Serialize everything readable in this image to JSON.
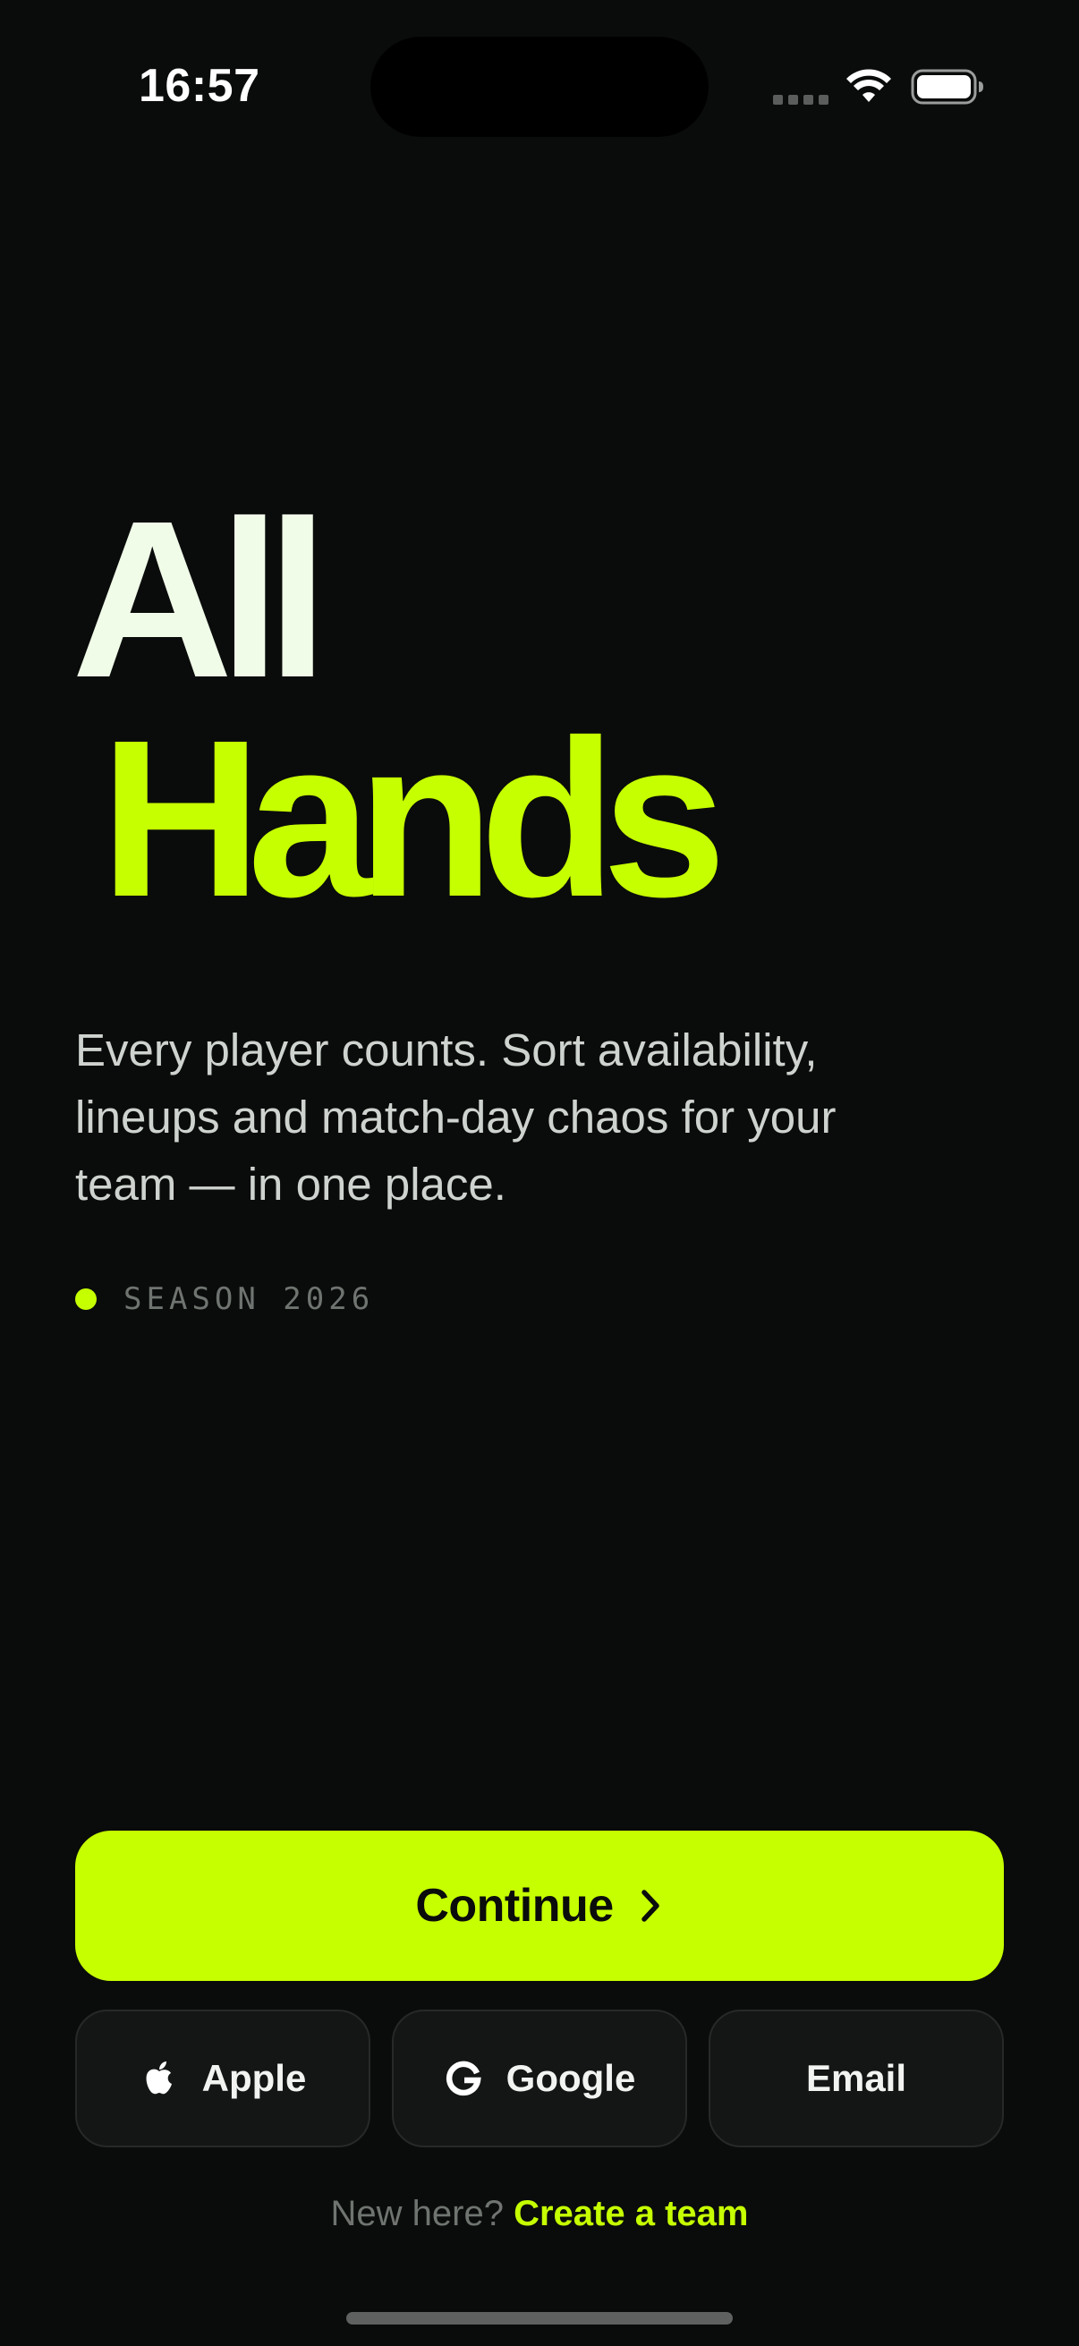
{
  "status_bar": {
    "time": "16:57",
    "signal_icon": "signal-dots-icon",
    "wifi_icon": "wifi-icon",
    "battery_icon": "battery-icon"
  },
  "hero": {
    "line_1": "All",
    "line_2": "Hands"
  },
  "tagline": "Every player counts. Sort availability, lineups and match-day chaos for your team — in one place.",
  "season": {
    "label": "SEASON 2026"
  },
  "actions": {
    "continue_label": "Continue",
    "continue_icon": "chevron-right-icon",
    "providers": [
      {
        "label": "Apple",
        "icon": "apple-icon"
      },
      {
        "label": "Google",
        "icon": "google-icon"
      },
      {
        "label": "Email",
        "icon": ""
      }
    ]
  },
  "footer": {
    "prompt": "New here?",
    "link": "Create a team"
  },
  "colors": {
    "background": "#0a0c0b",
    "accent": "#c6ff00",
    "hero_text": "#f0fbe8",
    "muted_text": "#6f7470",
    "surface": "#141615"
  }
}
